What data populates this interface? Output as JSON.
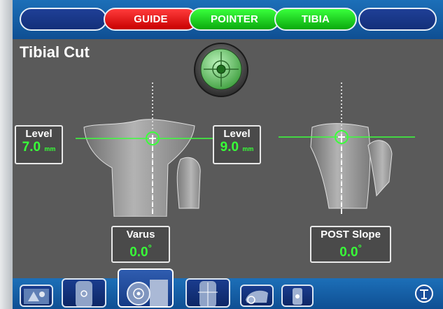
{
  "header": {
    "buttons": [
      {
        "label": "",
        "color": "#1a3a8f"
      },
      {
        "label": "GUIDE",
        "color": "#e81010"
      },
      {
        "label": "POINTER",
        "color": "#18c418"
      },
      {
        "label": "TIBIA",
        "color": "#18c418"
      },
      {
        "label": "",
        "color": "#1a3a8f"
      }
    ]
  },
  "page": {
    "title": "Tibial Cut"
  },
  "left_view": {
    "level": {
      "label": "Level",
      "value": "7.0",
      "unit": "mm"
    },
    "angle": {
      "label": "Varus",
      "value": "0.0",
      "unit": "°"
    }
  },
  "right_view": {
    "level": {
      "label": "Level",
      "value": "9.0",
      "unit": "mm"
    },
    "angle": {
      "label": "POST Slope",
      "value": "0.0",
      "unit": "°"
    }
  },
  "icons": {
    "bubble_level": "bubble-level-icon",
    "logo": "t-logo-icon"
  },
  "colors": {
    "accent_green": "#38ff38",
    "guide_red": "#e81010",
    "toolbar_blue": "#1565b0"
  }
}
